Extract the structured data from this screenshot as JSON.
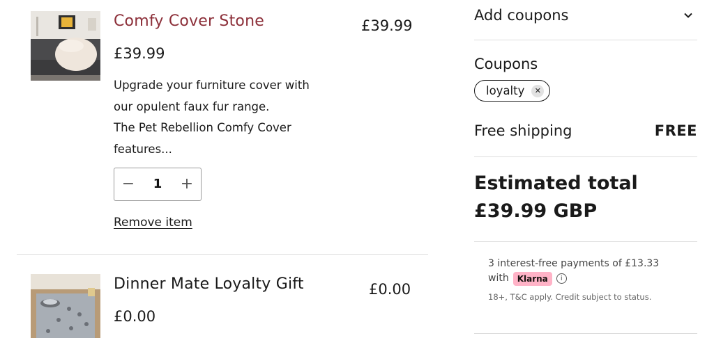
{
  "cart": {
    "items": [
      {
        "title": "Comfy Cover Stone",
        "price": "£39.99",
        "line_total": "£39.99",
        "description_lines": [
          "Upgrade your furniture cover with",
          "our opulent faux fur range.",
          "The Pet Rebellion Comfy Cover",
          "features..."
        ],
        "quantity": "1",
        "remove_label": "Remove item"
      },
      {
        "title": "Dinner Mate Loyalty Gift",
        "price": "£0.00",
        "line_total": "£0.00"
      }
    ],
    "qty_minus_symbol": "−",
    "qty_plus_symbol": "+"
  },
  "summary": {
    "add_coupons_label": "Add coupons",
    "coupons_label": "Coupons",
    "applied_coupon": "loyalty",
    "coupon_remove_symbol": "✕",
    "shipping_label": "Free shipping",
    "shipping_value": "FREE",
    "estimated_total_label": "Estimated total",
    "estimated_total_value": "£39.99 GBP",
    "klarna": {
      "line1": "3 interest-free payments of £13.33",
      "with_label": "with",
      "brand": "Klarna",
      "info_symbol": "i",
      "fine_print": "18+, T&C apply. Credit subject to status."
    }
  },
  "colors": {
    "title_accent": "#8c2f39",
    "klarna_pink": "#ffb3c7"
  },
  "icons": [
    "chevron-down-icon",
    "close-icon",
    "info-icon"
  ]
}
